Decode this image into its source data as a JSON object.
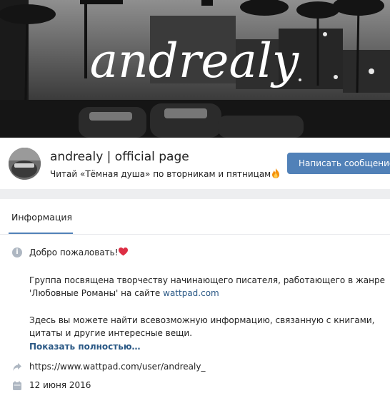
{
  "cover": {
    "logo_text": "andrealy"
  },
  "header": {
    "group_name": "andrealy | official page",
    "status": "Читай «Тёмная душа» по вторникам и пятницам",
    "status_emoji": "fire-icon",
    "message_button": "Написать сообщение"
  },
  "tabs": [
    {
      "label": "Информация",
      "active": true
    }
  ],
  "info": {
    "greeting": "Добро пожаловать!",
    "greeting_emoji": "heart-icon",
    "line1": "Группа посвящена творчеству начинающего писателя, работающего в жанре",
    "line2_prefix": "'Любовные Романы' на сайте ",
    "line2_link": "wattpad.com",
    "line3": "Здесь вы можете найти всевозможную информацию, связанную с книгами,",
    "line4": "цитаты и другие интересные вещи.",
    "show_more": "Показать полностью…",
    "website": "https://www.wattpad.com/user/andrealy_",
    "date": "12 июня 2016"
  },
  "colors": {
    "accent": "#5181b8",
    "link": "#2a5885",
    "page_bg": "#edeef0",
    "icon_gray": "#aeb7c2"
  }
}
